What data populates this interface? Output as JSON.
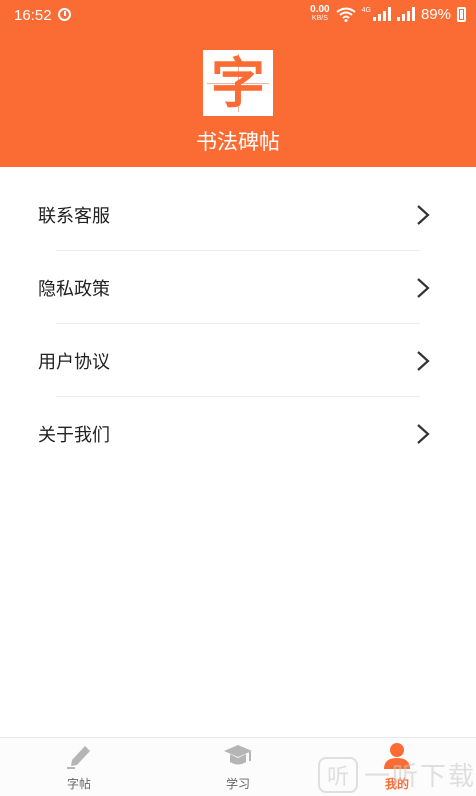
{
  "status_bar": {
    "time": "16:52",
    "net_speed_value": "0.00",
    "net_speed_unit": "KB/S",
    "network_type": "4G",
    "battery": "89%"
  },
  "header": {
    "logo_char": "字",
    "app_name": "书法碑帖",
    "background_color": "#fb6c35"
  },
  "menu": {
    "items": [
      {
        "label": "联系客服",
        "icon": "chevron-right-icon"
      },
      {
        "label": "隐私政策",
        "icon": "chevron-right-icon"
      },
      {
        "label": "用户协议",
        "icon": "chevron-right-icon"
      },
      {
        "label": "关于我们",
        "icon": "chevron-right-icon"
      }
    ]
  },
  "tabbar": {
    "tabs": [
      {
        "label": "字帖",
        "icon": "pen-icon",
        "active": false
      },
      {
        "label": "学习",
        "icon": "graduation-cap-icon",
        "active": false
      },
      {
        "label": "我的",
        "icon": "person-icon",
        "active": true
      }
    ],
    "active_color": "#fb6c35",
    "inactive_color": "#b5b5b5"
  },
  "watermark": {
    "icon_text": "听",
    "text": "一听下载"
  }
}
